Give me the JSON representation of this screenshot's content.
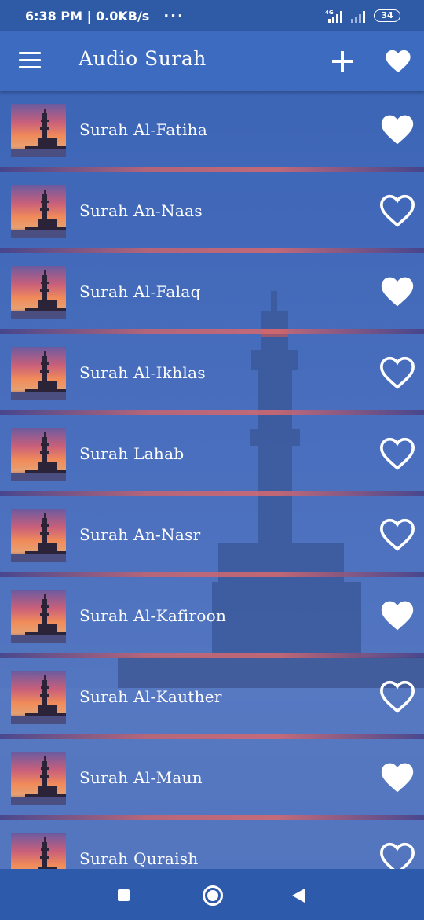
{
  "status_bar": {
    "time_speed": "6:38 PM | 0.0KB/s",
    "more": "···",
    "network": "4G",
    "battery": "34"
  },
  "app_bar": {
    "title": "Audio Surah"
  },
  "surahs": [
    {
      "name": "Surah Al-Fatiha",
      "favorite": true
    },
    {
      "name": "Surah An-Naas",
      "favorite": false
    },
    {
      "name": "Surah Al-Falaq",
      "favorite": true
    },
    {
      "name": "Surah Al-Ikhlas",
      "favorite": false
    },
    {
      "name": "Surah Lahab",
      "favorite": false
    },
    {
      "name": "Surah An-Nasr",
      "favorite": false
    },
    {
      "name": "Surah Al-Kafiroon",
      "favorite": true
    },
    {
      "name": "Surah Al-Kauther",
      "favorite": false
    },
    {
      "name": "Surah Al-Maun",
      "favorite": true
    },
    {
      "name": "Surah Quraish",
      "favorite": false
    }
  ],
  "colors": {
    "app_bar": "#3d6bc0",
    "status_bar": "#2f5aa6",
    "heart": "#ffffff"
  }
}
